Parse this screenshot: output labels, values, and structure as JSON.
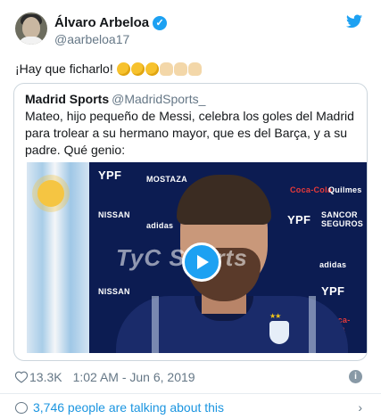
{
  "author": {
    "display_name": "Álvaro Arbeloa",
    "handle": "@aarbeloa17"
  },
  "tweet": {
    "text": "¡Hay que ficharlo! ",
    "emojis": [
      "rofl",
      "rofl",
      "rofl",
      "raising-hands",
      "raising-hands",
      "raising-hands"
    ]
  },
  "quoted": {
    "display_name": "Madrid Sports",
    "handle": "@MadridSports_",
    "text": "Mateo, hijo pequeño de Messi, celebra los goles del Madrid para trolear a su hermano mayor, que es del Barça, y a su padre. Qué genio:",
    "video": {
      "sponsors": [
        "YPF",
        "MOSTAZA",
        "NISSAN",
        "adidas",
        "Coca-Cola",
        "Quilmes",
        "SANCOR SEGUROS"
      ],
      "watermark": "TyC Sports"
    }
  },
  "meta": {
    "likes": "13.3K",
    "timestamp": "1:02 AM - Jun 6, 2019"
  },
  "footer": {
    "talking": "3,746 people are talking about this"
  },
  "colors": {
    "accent": "#1da1f2",
    "secondary_text": "#657786",
    "link": "#1b95e0"
  }
}
